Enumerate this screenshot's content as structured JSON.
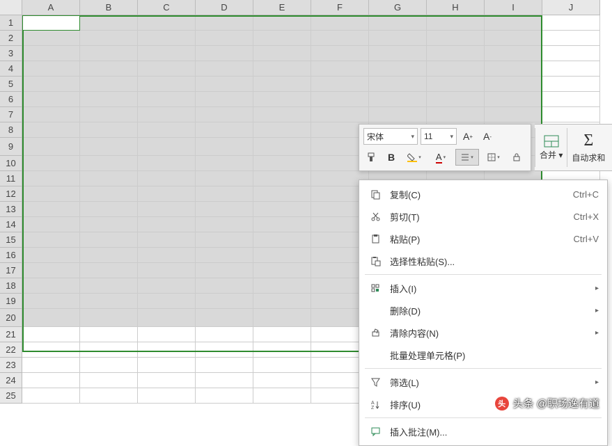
{
  "columns": [
    "A",
    "B",
    "C",
    "D",
    "E",
    "F",
    "G",
    "H",
    "I",
    "J"
  ],
  "rows": [
    "1",
    "2",
    "3",
    "4",
    "5",
    "6",
    "7",
    "8",
    "9",
    "10",
    "11",
    "12",
    "13",
    "14",
    "15",
    "16",
    "17",
    "18",
    "19",
    "20",
    "21",
    "22",
    "23",
    "24",
    "25"
  ],
  "selected_cols": 9,
  "selected_rows": 20,
  "tall_rows": [
    9,
    20
  ],
  "mini_toolbar": {
    "font": "宋体",
    "size": "11",
    "grow_label": "A⁺",
    "shrink_label": "A⁻"
  },
  "ribbon": {
    "merge": "合并 ▾",
    "autosum": "自动求和"
  },
  "context_menu": [
    {
      "type": "item",
      "icon": "copy",
      "label": "复制(C)",
      "shortcut": "Ctrl+C"
    },
    {
      "type": "item",
      "icon": "cut",
      "label": "剪切(T)",
      "shortcut": "Ctrl+X"
    },
    {
      "type": "item",
      "icon": "paste",
      "label": "粘贴(P)",
      "shortcut": "Ctrl+V"
    },
    {
      "type": "item",
      "icon": "paste-special",
      "label": "选择性粘贴(S)...",
      "shortcut": ""
    },
    {
      "type": "sep"
    },
    {
      "type": "item",
      "icon": "insert",
      "label": "插入(I)",
      "submenu": true
    },
    {
      "type": "item",
      "icon": "",
      "label": "删除(D)",
      "submenu": true
    },
    {
      "type": "item",
      "icon": "clear",
      "label": "清除内容(N)",
      "submenu": true
    },
    {
      "type": "item",
      "icon": "",
      "label": "批量处理单元格(P)"
    },
    {
      "type": "sep"
    },
    {
      "type": "item",
      "icon": "filter",
      "label": "筛选(L)",
      "submenu": true
    },
    {
      "type": "item",
      "icon": "sort",
      "label": "排序(U)",
      "submenu": true
    },
    {
      "type": "sep"
    },
    {
      "type": "item",
      "icon": "comment",
      "label": "插入批注(M)..."
    }
  ],
  "watermark": "头条 @职场逸有道"
}
